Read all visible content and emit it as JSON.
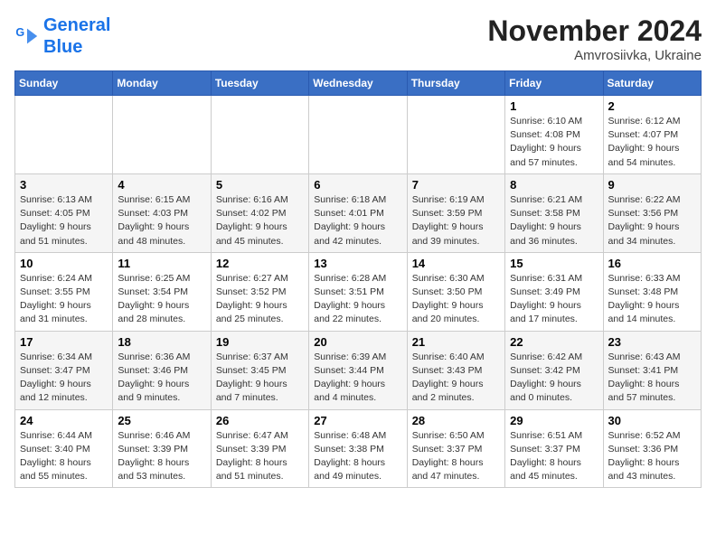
{
  "header": {
    "logo_line1": "General",
    "logo_line2": "Blue",
    "month": "November 2024",
    "location": "Amvrosiivka, Ukraine"
  },
  "weekdays": [
    "Sunday",
    "Monday",
    "Tuesday",
    "Wednesday",
    "Thursday",
    "Friday",
    "Saturday"
  ],
  "weeks": [
    [
      {
        "day": "",
        "info": ""
      },
      {
        "day": "",
        "info": ""
      },
      {
        "day": "",
        "info": ""
      },
      {
        "day": "",
        "info": ""
      },
      {
        "day": "",
        "info": ""
      },
      {
        "day": "1",
        "info": "Sunrise: 6:10 AM\nSunset: 4:08 PM\nDaylight: 9 hours\nand 57 minutes."
      },
      {
        "day": "2",
        "info": "Sunrise: 6:12 AM\nSunset: 4:07 PM\nDaylight: 9 hours\nand 54 minutes."
      }
    ],
    [
      {
        "day": "3",
        "info": "Sunrise: 6:13 AM\nSunset: 4:05 PM\nDaylight: 9 hours\nand 51 minutes."
      },
      {
        "day": "4",
        "info": "Sunrise: 6:15 AM\nSunset: 4:03 PM\nDaylight: 9 hours\nand 48 minutes."
      },
      {
        "day": "5",
        "info": "Sunrise: 6:16 AM\nSunset: 4:02 PM\nDaylight: 9 hours\nand 45 minutes."
      },
      {
        "day": "6",
        "info": "Sunrise: 6:18 AM\nSunset: 4:01 PM\nDaylight: 9 hours\nand 42 minutes."
      },
      {
        "day": "7",
        "info": "Sunrise: 6:19 AM\nSunset: 3:59 PM\nDaylight: 9 hours\nand 39 minutes."
      },
      {
        "day": "8",
        "info": "Sunrise: 6:21 AM\nSunset: 3:58 PM\nDaylight: 9 hours\nand 36 minutes."
      },
      {
        "day": "9",
        "info": "Sunrise: 6:22 AM\nSunset: 3:56 PM\nDaylight: 9 hours\nand 34 minutes."
      }
    ],
    [
      {
        "day": "10",
        "info": "Sunrise: 6:24 AM\nSunset: 3:55 PM\nDaylight: 9 hours\nand 31 minutes."
      },
      {
        "day": "11",
        "info": "Sunrise: 6:25 AM\nSunset: 3:54 PM\nDaylight: 9 hours\nand 28 minutes."
      },
      {
        "day": "12",
        "info": "Sunrise: 6:27 AM\nSunset: 3:52 PM\nDaylight: 9 hours\nand 25 minutes."
      },
      {
        "day": "13",
        "info": "Sunrise: 6:28 AM\nSunset: 3:51 PM\nDaylight: 9 hours\nand 22 minutes."
      },
      {
        "day": "14",
        "info": "Sunrise: 6:30 AM\nSunset: 3:50 PM\nDaylight: 9 hours\nand 20 minutes."
      },
      {
        "day": "15",
        "info": "Sunrise: 6:31 AM\nSunset: 3:49 PM\nDaylight: 9 hours\nand 17 minutes."
      },
      {
        "day": "16",
        "info": "Sunrise: 6:33 AM\nSunset: 3:48 PM\nDaylight: 9 hours\nand 14 minutes."
      }
    ],
    [
      {
        "day": "17",
        "info": "Sunrise: 6:34 AM\nSunset: 3:47 PM\nDaylight: 9 hours\nand 12 minutes."
      },
      {
        "day": "18",
        "info": "Sunrise: 6:36 AM\nSunset: 3:46 PM\nDaylight: 9 hours\nand 9 minutes."
      },
      {
        "day": "19",
        "info": "Sunrise: 6:37 AM\nSunset: 3:45 PM\nDaylight: 9 hours\nand 7 minutes."
      },
      {
        "day": "20",
        "info": "Sunrise: 6:39 AM\nSunset: 3:44 PM\nDaylight: 9 hours\nand 4 minutes."
      },
      {
        "day": "21",
        "info": "Sunrise: 6:40 AM\nSunset: 3:43 PM\nDaylight: 9 hours\nand 2 minutes."
      },
      {
        "day": "22",
        "info": "Sunrise: 6:42 AM\nSunset: 3:42 PM\nDaylight: 9 hours\nand 0 minutes."
      },
      {
        "day": "23",
        "info": "Sunrise: 6:43 AM\nSunset: 3:41 PM\nDaylight: 8 hours\nand 57 minutes."
      }
    ],
    [
      {
        "day": "24",
        "info": "Sunrise: 6:44 AM\nSunset: 3:40 PM\nDaylight: 8 hours\nand 55 minutes."
      },
      {
        "day": "25",
        "info": "Sunrise: 6:46 AM\nSunset: 3:39 PM\nDaylight: 8 hours\nand 53 minutes."
      },
      {
        "day": "26",
        "info": "Sunrise: 6:47 AM\nSunset: 3:39 PM\nDaylight: 8 hours\nand 51 minutes."
      },
      {
        "day": "27",
        "info": "Sunrise: 6:48 AM\nSunset: 3:38 PM\nDaylight: 8 hours\nand 49 minutes."
      },
      {
        "day": "28",
        "info": "Sunrise: 6:50 AM\nSunset: 3:37 PM\nDaylight: 8 hours\nand 47 minutes."
      },
      {
        "day": "29",
        "info": "Sunrise: 6:51 AM\nSunset: 3:37 PM\nDaylight: 8 hours\nand 45 minutes."
      },
      {
        "day": "30",
        "info": "Sunrise: 6:52 AM\nSunset: 3:36 PM\nDaylight: 8 hours\nand 43 minutes."
      }
    ]
  ]
}
